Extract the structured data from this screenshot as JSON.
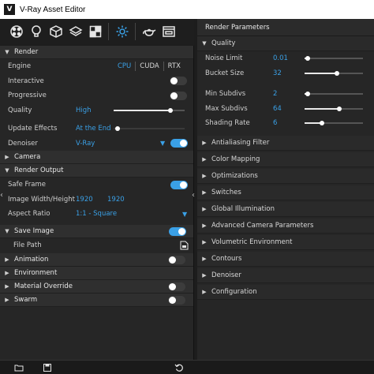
{
  "window": {
    "title": "V-Ray Asset Editor",
    "app_icon": "V"
  },
  "toolbar": {
    "tools": [
      "materials-icon",
      "lights-icon",
      "geometry-icon",
      "layers-icon",
      "textures-icon",
      "settings-icon",
      "render-teapot-icon",
      "frame-buffer-icon"
    ],
    "active_tool": "settings-icon",
    "accent": "#3aa0e6"
  },
  "left": {
    "render": {
      "title": "Render",
      "engine_label": "Engine",
      "engine_options": [
        "CPU",
        "CUDA",
        "RTX"
      ],
      "engine_selected": "CPU",
      "interactive_label": "Interactive",
      "interactive_on": false,
      "progressive_label": "Progressive",
      "progressive_on": false,
      "quality_label": "Quality",
      "quality_value": "High",
      "update_effects_label": "Update Effects",
      "update_effects_value": "At the End",
      "denoiser_label": "Denoiser",
      "denoiser_value": "V-Ray",
      "denoiser_on": true
    },
    "camera": {
      "title": "Camera"
    },
    "render_output": {
      "title": "Render Output",
      "safe_frame_label": "Safe Frame",
      "safe_frame_on": true,
      "size_label": "Image Width/Height",
      "width": "1920",
      "height": "1920",
      "aspect_label": "Aspect Ratio",
      "aspect_value": "1:1 - Square"
    },
    "save_image": {
      "title": "Save Image",
      "on": true,
      "file_path_label": "File Path"
    },
    "animation": {
      "title": "Animation",
      "on": false
    },
    "environment": {
      "title": "Environment"
    },
    "material_override": {
      "title": "Material Override",
      "on": false
    },
    "swarm": {
      "title": "Swarm",
      "on": false
    }
  },
  "right": {
    "header": "Render Parameters",
    "quality": {
      "title": "Quality",
      "rows": [
        {
          "label": "Noise Limit",
          "value": "0.01",
          "slider": 0.05
        },
        {
          "label": "Bucket Size",
          "value": "32",
          "slider": 0.55
        },
        {
          "label": "Min Subdivs",
          "value": "2",
          "slider": 0.05
        },
        {
          "label": "Max Subdivs",
          "value": "64",
          "slider": 0.6
        },
        {
          "label": "Shading Rate",
          "value": "6",
          "slider": 0.3
        }
      ]
    },
    "sections": [
      "Antialiasing Filter",
      "Color Mapping",
      "Optimizations",
      "Switches",
      "Global Illumination",
      "Advanced Camera Parameters",
      "Volumetric Environment",
      "Contours",
      "Denoiser",
      "Configuration"
    ]
  },
  "statusbar": {
    "icons": [
      "open-folder-icon",
      "save-icon",
      "reset-icon"
    ]
  }
}
